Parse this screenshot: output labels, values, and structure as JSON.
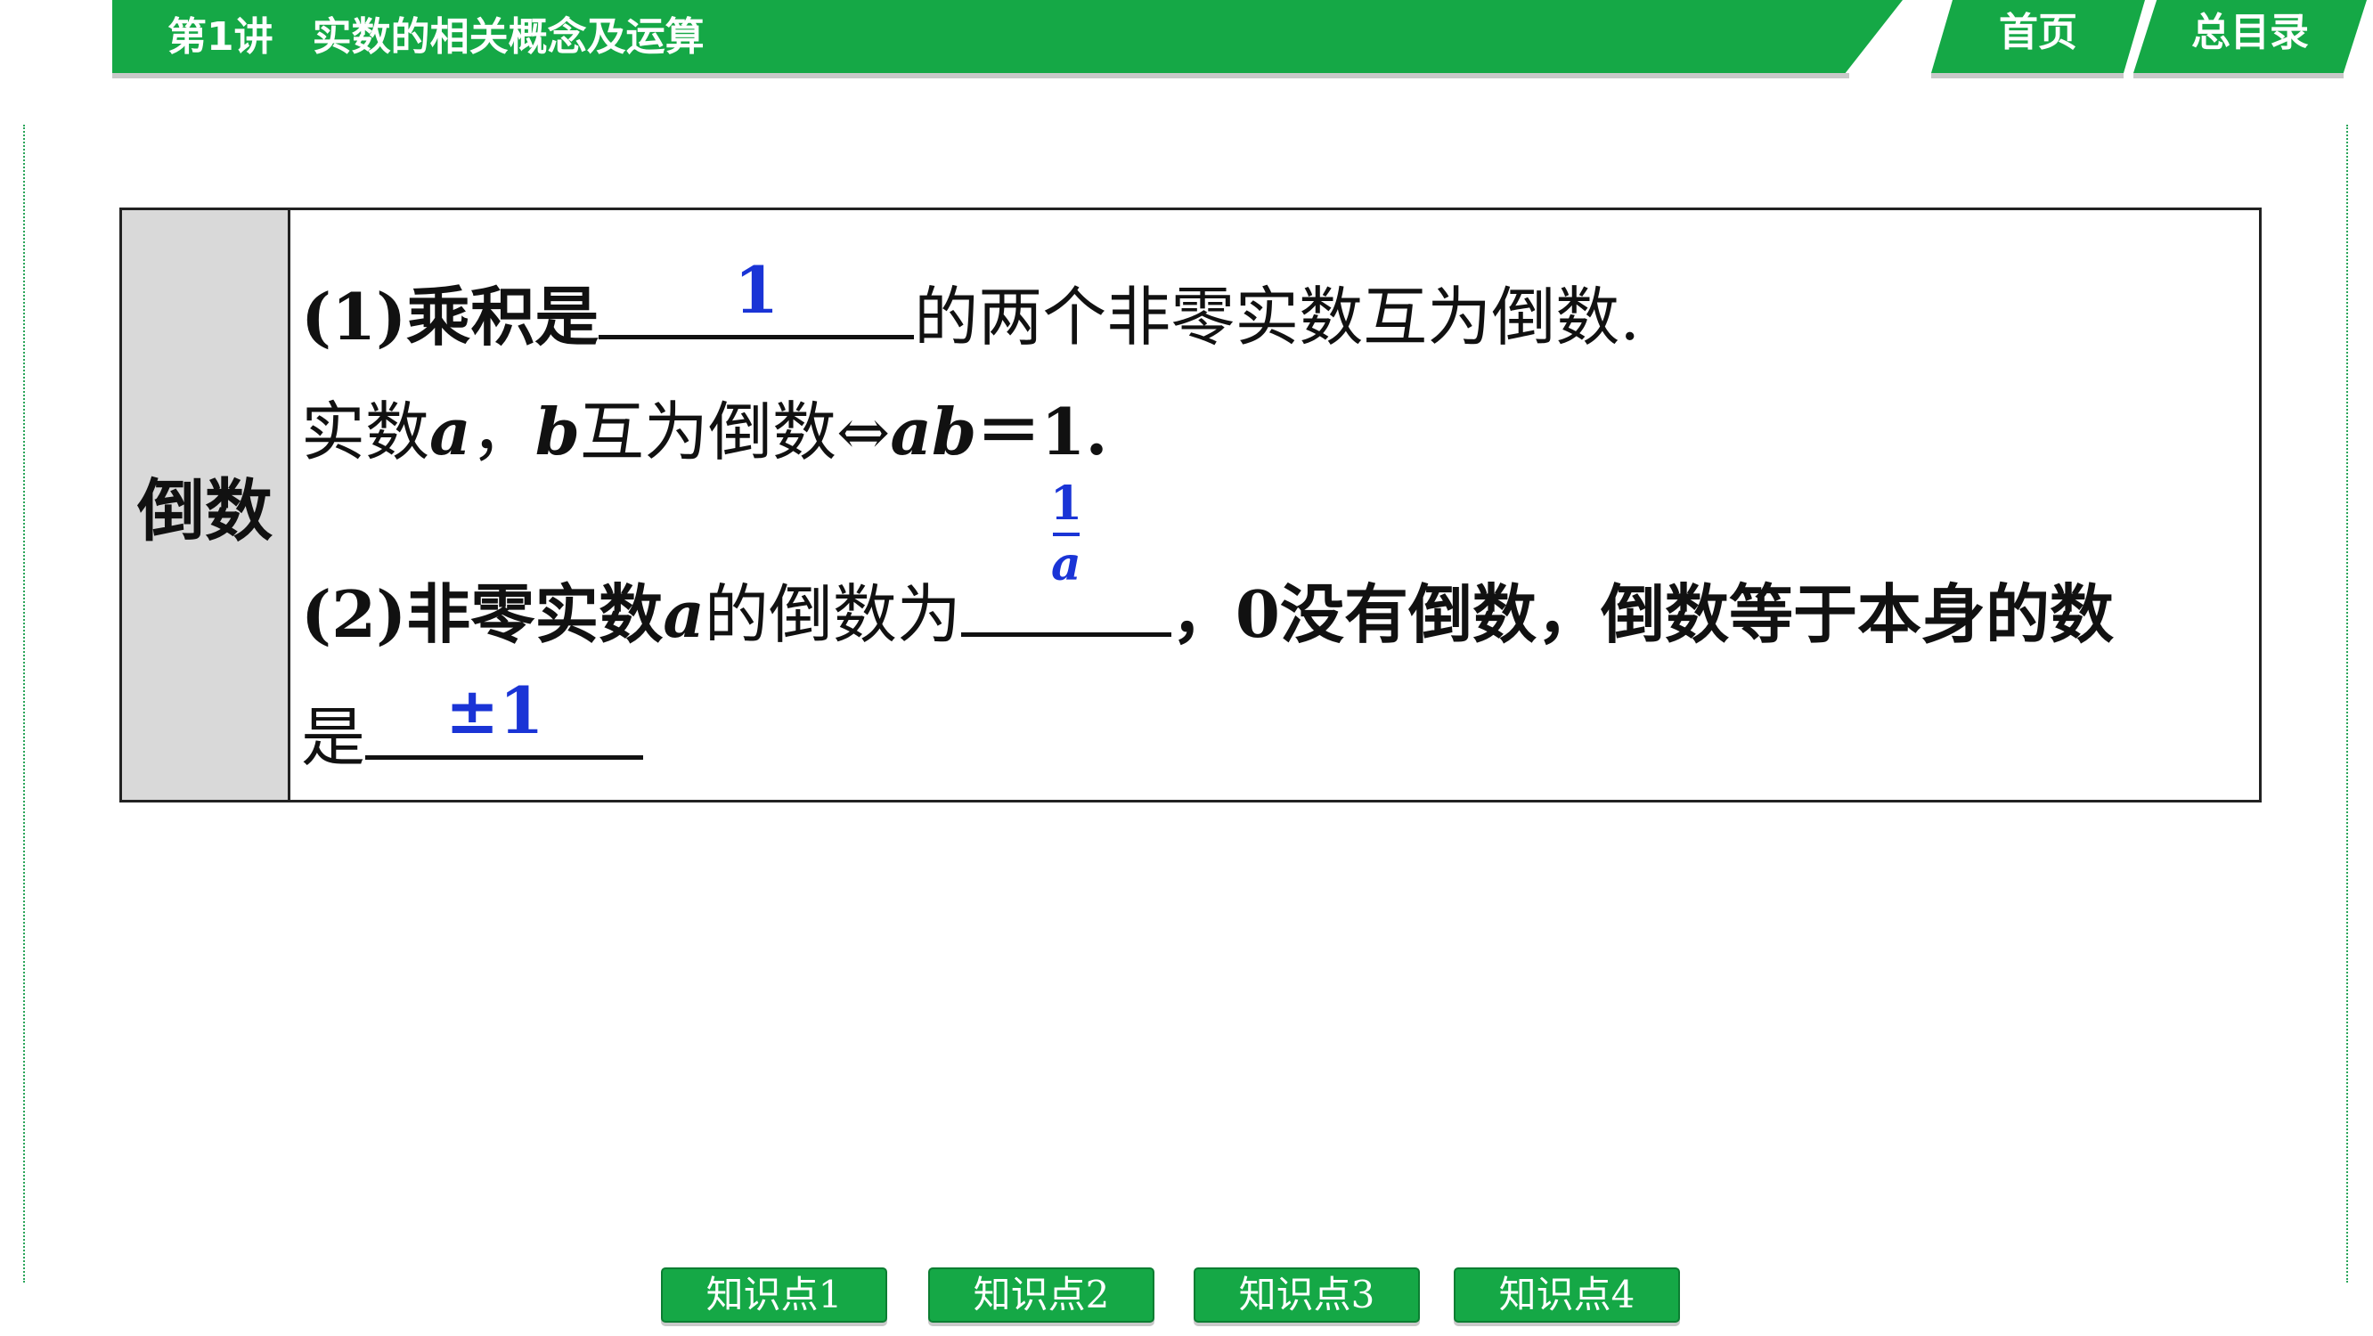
{
  "header": {
    "lesson": "第1讲",
    "title": "实数的相关概念及运算",
    "home_label": "首页",
    "toc_label": "总目录"
  },
  "definition": {
    "label": "倒数",
    "line1_prefix": "(1)乘积是",
    "line1_answer": "1",
    "line1_suffix": "的两个非零实数互为倒数.",
    "line2_a": "实数",
    "line2_var_a": "a",
    "line2_comma": "，",
    "line2_var_b": "b",
    "line2_mid": "互为倒数⇔",
    "line2_var_ab": "ab",
    "line2_end": "＝1.",
    "line3_prefix": "(2)非零实数",
    "line3_var_a": "a",
    "line3_mid": "的倒数为",
    "line3_frac_num": "1",
    "line3_frac_den": "a",
    "line3_suffix": "，0没有倒数，倒数等于本身的数",
    "line4_prefix": "是",
    "line4_answer": "±1"
  },
  "tabs": [
    "知识点1",
    "知识点2",
    "知识点3",
    "知识点4"
  ],
  "colors": {
    "brand_green": "#15a846",
    "answer_blue": "#1a34d6",
    "label_gray": "#d9d9d9"
  }
}
